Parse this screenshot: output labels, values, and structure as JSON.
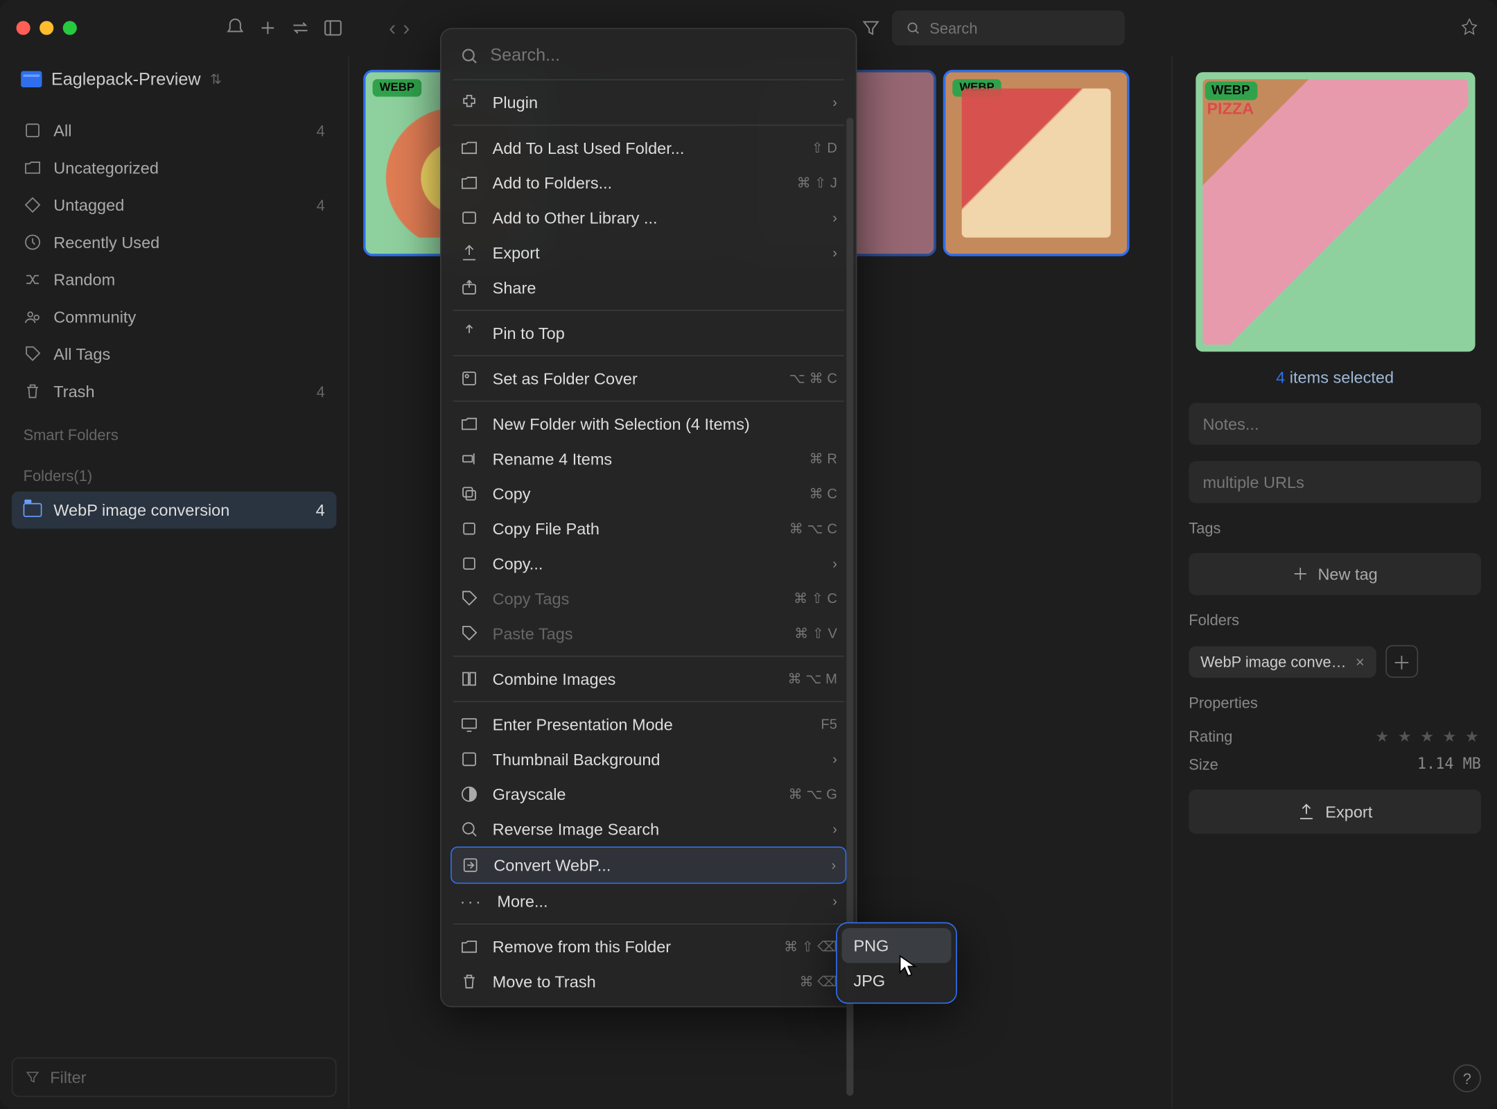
{
  "library": {
    "name": "Eaglepack-Preview"
  },
  "sidebar": {
    "items": [
      {
        "label": "All",
        "count": "4"
      },
      {
        "label": "Uncategorized",
        "count": ""
      },
      {
        "label": "Untagged",
        "count": "4"
      },
      {
        "label": "Recently Used",
        "count": ""
      },
      {
        "label": "Random",
        "count": ""
      },
      {
        "label": "Community",
        "count": ""
      },
      {
        "label": "All Tags",
        "count": ""
      },
      {
        "label": "Trash",
        "count": "4"
      }
    ],
    "smart_label": "Smart Folders",
    "folders_label": "Folders(1)",
    "folders": [
      {
        "label": "WebP image conversion",
        "count": "4"
      }
    ],
    "filter": "Filter"
  },
  "toolbar": {
    "search_placeholder": "Search"
  },
  "thumbs": {
    "badge": "WEBP"
  },
  "context": {
    "search_placeholder": "Search...",
    "items": {
      "plugin": "Plugin",
      "add_last": "Add To Last Used Folder...",
      "add_last_sc": "⇧ D",
      "add_folders": "Add to Folders...",
      "add_folders_sc": "⌘ ⇧ J",
      "add_other": "Add to Other Library ...",
      "export": "Export",
      "share": "Share",
      "pin": "Pin to Top",
      "cover": "Set as Folder Cover",
      "cover_sc": "⌥ ⌘ C",
      "new_folder": "New Folder with Selection (4 Items)",
      "rename": "Rename 4 Items",
      "rename_sc": "⌘ R",
      "copy": "Copy",
      "copy_sc": "⌘ C",
      "copy_path": "Copy File Path",
      "copy_path_sc": "⌘ ⌥ C",
      "copy_more": "Copy...",
      "copy_tags": "Copy Tags",
      "copy_tags_sc": "⌘ ⇧ C",
      "paste_tags": "Paste Tags",
      "paste_tags_sc": "⌘ ⇧ V",
      "combine": "Combine Images",
      "combine_sc": "⌘ ⌥ M",
      "presentation": "Enter Presentation Mode",
      "presentation_sc": "F5",
      "thumb_bg": "Thumbnail Background",
      "grayscale": "Grayscale",
      "grayscale_sc": "⌘ ⌥ G",
      "reverse": "Reverse Image Search",
      "convert": "Convert WebP...",
      "more": "More...",
      "remove": "Remove from this Folder",
      "remove_sc": "⌘ ⇧ ⌫",
      "trash": "Move to Trash",
      "trash_sc": "⌘ ⌫"
    },
    "submenu": {
      "png": "PNG",
      "jpg": "JPG"
    }
  },
  "inspector": {
    "badge": "WEBP",
    "preview_text": "PIZZA",
    "selected_n": "4",
    "selected_suffix": " items selected",
    "notes_placeholder": "Notes...",
    "urls": "multiple URLs",
    "tags_label": "Tags",
    "new_tag": "New tag",
    "folders_label": "Folders",
    "folder_chip": "WebP image conve…",
    "props_label": "Properties",
    "rating_label": "Rating",
    "size_label": "Size",
    "size_value": "1.14 MB",
    "export": "Export"
  }
}
